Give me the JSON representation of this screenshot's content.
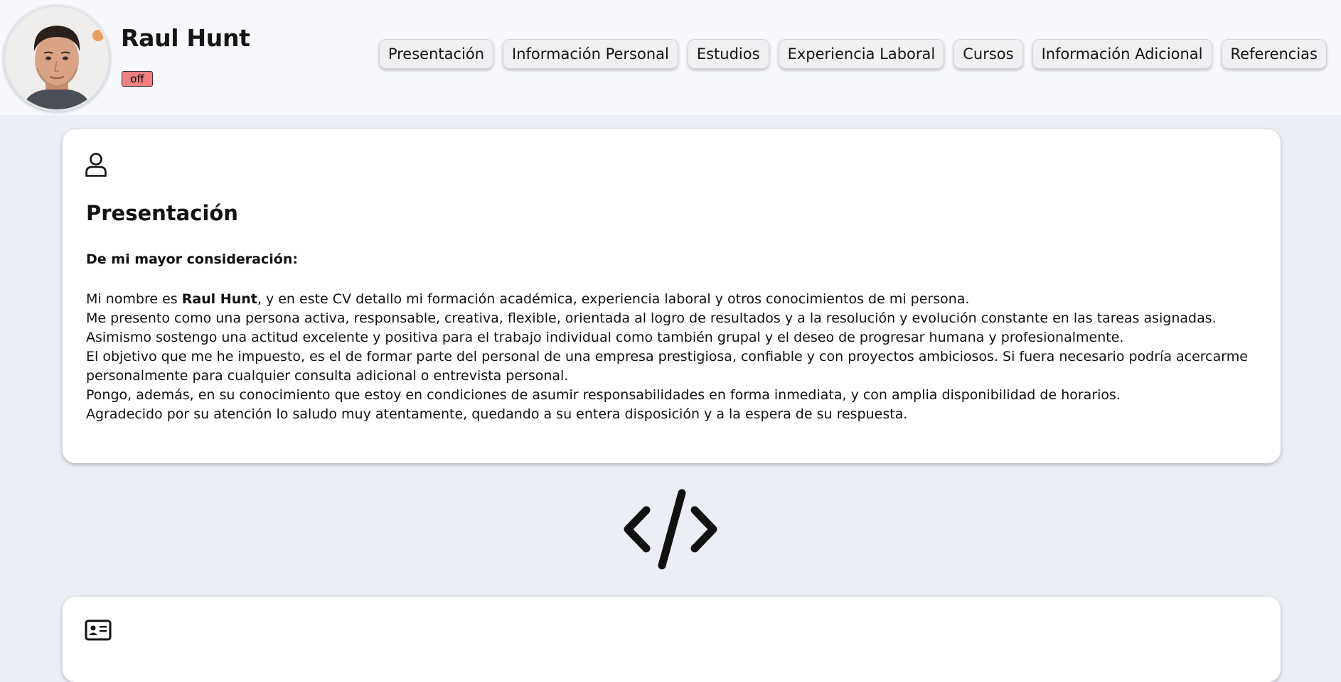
{
  "profile": {
    "name": "Raul Hunt",
    "status": "off"
  },
  "nav": {
    "items": [
      {
        "label": "Presentación"
      },
      {
        "label": "Información Personal"
      },
      {
        "label": "Estudios"
      },
      {
        "label": "Experiencia Laboral"
      },
      {
        "label": "Cursos"
      },
      {
        "label": "Información Adicional"
      },
      {
        "label": "Referencias"
      }
    ]
  },
  "presentation": {
    "icon": "user-icon",
    "title": "Presentación",
    "greeting": "De mi mayor consideración:",
    "intro_before": "Mi nombre es ",
    "intro_name": "Raul Hunt",
    "intro_after": ", y en este CV detallo mi formación académica, experiencia laboral y otros conocimientos de mi persona.",
    "paragraph_2": "Me presento como una persona activa, responsable, creativa, flexible, orientada al logro de resultados y a la resolución y evolución constante en las tareas asignadas. Asimismo sostengo una actitud excelente y positiva para el trabajo individual como también grupal y el deseo de progresar humana y profesionalmente.",
    "paragraph_3": "El objetivo que me he impuesto, es el de formar parte del personal de una empresa prestigiosa, confiable y con proyectos ambiciosos. Si fuera necesario podría acercarme personalmente para cualquier consulta adicional o entrevista personal.",
    "paragraph_4": "Pongo, además, en su conocimiento que estoy en condiciones de asumir responsabilidades en forma inmediata, y con amplia disponibilidad de horarios.",
    "paragraph_5": "Agradecido por su atención lo saludo muy atentamente, quedando a su entera disposición y a la espera de su respuesta."
  },
  "divider": {
    "icon": "code-icon"
  },
  "personal": {
    "icon": "id-card-icon"
  },
  "colors": {
    "page_bg": "#eceef5",
    "header_bg": "#f7f8fc",
    "badge_off": "#f08080"
  }
}
